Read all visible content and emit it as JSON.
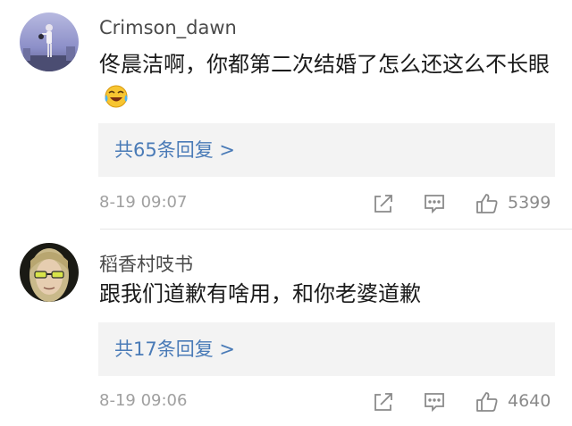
{
  "comments": [
    {
      "username": "Crimson_dawn",
      "text": "佟晨洁啊，你都第二次结婚了怎么还这么不长眼",
      "emoji": "laughing-crying-emoji",
      "replies_label": "共65条回复 >",
      "time": "8-19 09:07",
      "likes": "5399"
    },
    {
      "username": "稻香村吱书",
      "text": "跟我们道歉有啥用，和你老婆道歉",
      "replies_label": "共17条回复 >",
      "time": "8-19 09:06",
      "likes": "4640"
    }
  ],
  "colors": {
    "link": "#4a7bb7",
    "muted": "#a0a0a0",
    "reply_bg": "#f3f3f3"
  },
  "icons": [
    "share-icon",
    "comment-icon",
    "thumbs-up-icon"
  ]
}
